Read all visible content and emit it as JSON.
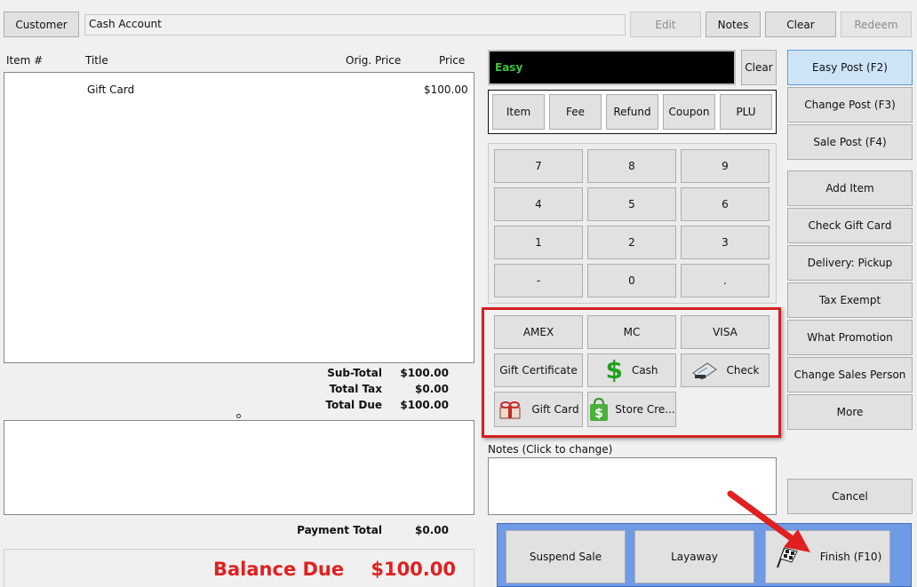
{
  "top": {
    "customer_label": "Customer",
    "account_value": "Cash Account",
    "edit_label": "Edit",
    "notes_label": "Notes",
    "clear_label": "Clear",
    "redeem_label": "Redeem"
  },
  "items": {
    "columns": [
      "Item #",
      "Title",
      "Orig. Price",
      "Price"
    ],
    "rows": [
      {
        "item_no": "",
        "title": "Gift Card",
        "orig_price": "",
        "price": "$100.00"
      }
    ]
  },
  "totals": {
    "subtotal_label": "Sub-Total",
    "subtotal_value": "$100.00",
    "tax_label": "Total Tax",
    "tax_value": "$0.00",
    "due_label": "Total Due",
    "due_value": "$100.00",
    "payment_total_label": "Payment Total",
    "payment_total_value": "$0.00",
    "balance_label": "Balance Due",
    "balance_value": "$100.00"
  },
  "entry": {
    "mode_text": "Easy",
    "clear_label": "Clear",
    "type_buttons": [
      "Item",
      "Fee",
      "Refund",
      "Coupon",
      "PLU"
    ]
  },
  "keypad": [
    "7",
    "8",
    "9",
    "4",
    "5",
    "6",
    "1",
    "2",
    "3",
    "-",
    "0",
    "."
  ],
  "payments": {
    "amex": "AMEX",
    "mc": "MC",
    "visa": "VISA",
    "gift_certificate": "Gift Certificate",
    "cash": "Cash",
    "check": "Check",
    "gift_card": "Gift Card",
    "store_credit": "Store Cre..."
  },
  "notes": {
    "label": "Notes (Click to change)",
    "value": ""
  },
  "right_menu": [
    "Easy Post (F2)",
    "Change Post (F3)",
    "Sale Post (F4)",
    "Add Item",
    "Check Gift Card",
    "Delivery: Pickup",
    "Tax Exempt",
    "What Promotion",
    "Change Sales Person",
    "More"
  ],
  "cancel_label": "Cancel",
  "bottom": {
    "suspend_label": "Suspend Sale",
    "layaway_label": "Layaway",
    "finish_label": "Finish (F10)"
  },
  "colors": {
    "accent_red": "#e02020",
    "highlight_box": "#d32020",
    "display_green": "#3ec43e",
    "bottom_panel": "#6f9ae6",
    "active_button": "#cde4f7"
  }
}
